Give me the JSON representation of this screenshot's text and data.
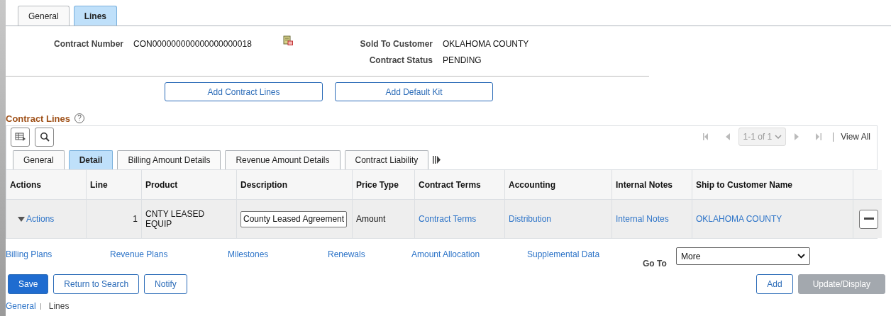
{
  "page_tabs": [
    {
      "label": "General",
      "selected": false
    },
    {
      "label": "Lines",
      "selected": true
    }
  ],
  "header": {
    "left": [
      {
        "label": "Contract Number",
        "value": "CON000000000000000000018"
      }
    ],
    "right": [
      {
        "label": "Sold To Customer",
        "value": "OKLAHOMA COUNTY"
      },
      {
        "label": "Contract Status",
        "value": "PENDING"
      }
    ]
  },
  "add_buttons": [
    "Add Contract Lines",
    "Add Default Kit"
  ],
  "contract_lines": {
    "title": "Contract Lines",
    "help": "?",
    "pager": {
      "range": "1-1 of 1",
      "view_all": "View All"
    },
    "tabs": [
      {
        "label": "General",
        "selected": false
      },
      {
        "label": "Detail",
        "selected": true
      },
      {
        "label": "Billing Amount Details",
        "selected": false
      },
      {
        "label": "Revenue Amount Details",
        "selected": false
      },
      {
        "label": "Contract Liability",
        "selected": false
      }
    ],
    "columns": [
      "Actions",
      "Line",
      "Product",
      "Description",
      "Price Type",
      "Contract Terms",
      "Accounting",
      "Internal Notes",
      "Ship to Customer Name"
    ],
    "rows": [
      {
        "actions": "Actions",
        "line": "1",
        "product": "CNTY LEASED EQUIP",
        "description": "County Leased Agreement",
        "price_type": "Amount",
        "contract_terms": "Contract Terms",
        "accounting": "Distribution",
        "internal_notes": "Internal Notes",
        "ship_to": "OKLAHOMA COUNTY"
      }
    ]
  },
  "links": [
    "Billing Plans",
    "Revenue Plans",
    "Milestones",
    "Renewals",
    "Amount Allocation",
    "Supplemental Data"
  ],
  "goto": {
    "label": "Go To",
    "value": "More"
  },
  "left_buttons": [
    {
      "label": "Save",
      "kind": "primary"
    },
    {
      "label": "Return to Search",
      "kind": "secondary"
    },
    {
      "label": "Notify",
      "kind": "secondary"
    }
  ],
  "right_buttons": [
    {
      "label": "Add",
      "kind": "secondary"
    },
    {
      "label": "Update/Display",
      "kind": "disabled"
    }
  ],
  "footer_links": [
    {
      "label": "General",
      "selected": false
    },
    {
      "label": "Lines",
      "selected": true
    }
  ]
}
